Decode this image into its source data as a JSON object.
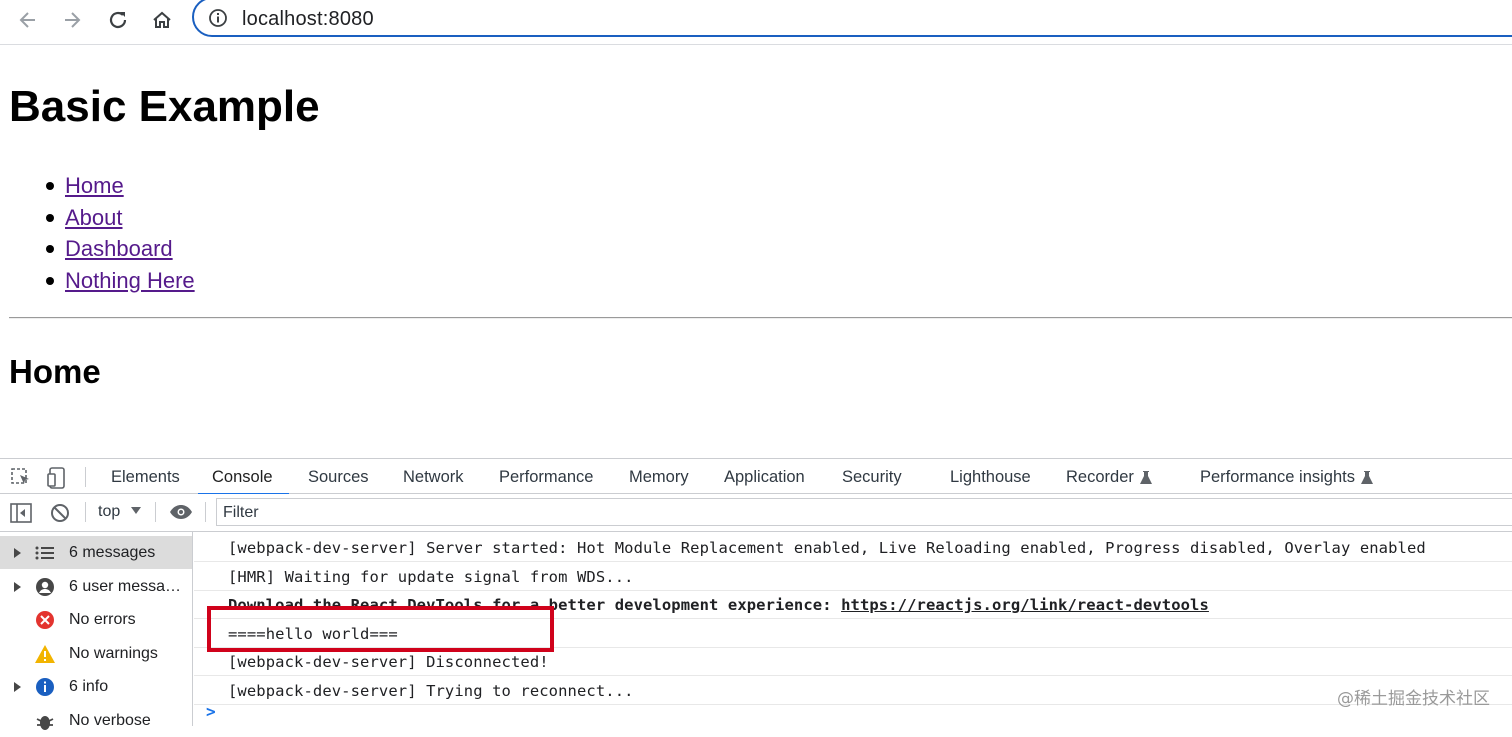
{
  "browser": {
    "url": "localhost:8080"
  },
  "page": {
    "title": "Basic Example",
    "nav": [
      "Home",
      "About",
      "Dashboard",
      "Nothing Here"
    ],
    "section_title": "Home"
  },
  "devtools": {
    "tabs": [
      "Elements",
      "Console",
      "Sources",
      "Network",
      "Performance",
      "Memory",
      "Application",
      "Security",
      "Lighthouse",
      "Recorder",
      "Performance insights"
    ],
    "active_tab": "Console",
    "context": "top",
    "filter_placeholder": "Filter",
    "sidebar": [
      {
        "label": "6 messages",
        "icon": "list-icon"
      },
      {
        "label": "6 user messa…",
        "icon": "user-icon"
      },
      {
        "label": "No errors",
        "icon": "error-icon"
      },
      {
        "label": "No warnings",
        "icon": "warning-icon"
      },
      {
        "label": "6 info",
        "icon": "info-icon"
      },
      {
        "label": "No verbose",
        "icon": "bug-icon"
      }
    ],
    "messages": [
      "[webpack-dev-server] Server started: Hot Module Replacement enabled, Live Reloading enabled, Progress disabled, Overlay enabled",
      "[HMR] Waiting for update signal from WDS...",
      "Download the React DevTools for a better development experience: ",
      "====hello world===",
      "[webpack-dev-server] Disconnected!",
      "[webpack-dev-server] Trying to reconnect..."
    ],
    "devtools_link": "https://reactjs.org/link/react-devtools",
    "prompt": ">"
  },
  "colors": {
    "link": "#551a8b",
    "highlight_border": "#d0021b",
    "tab_underline": "#1a73e8"
  },
  "watermark": "@稀土掘金技术社区"
}
